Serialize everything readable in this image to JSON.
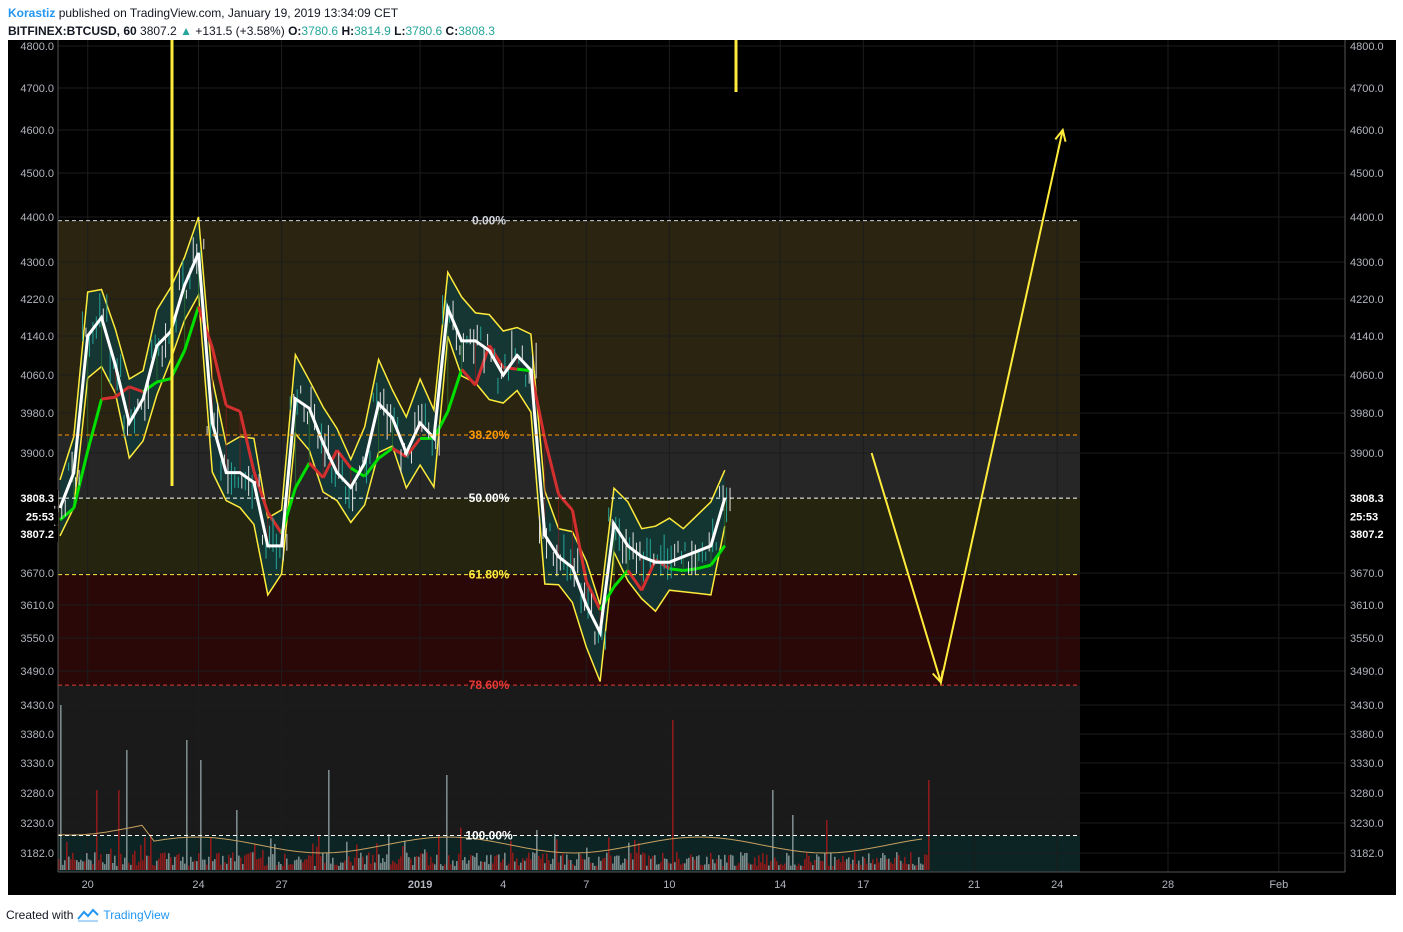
{
  "header": {
    "author": "Korastiz",
    "published": "published on TradingView.com, January 19, 2019 13:34:09 CET",
    "symbol": "BITFINEX:BTCUSD, 60",
    "last": "3807.2",
    "change": "+131.5 (+3.58%)",
    "open_label": "O:",
    "open": "3780.6",
    "high_label": "H:",
    "high": "3814.9",
    "low_label": "L:",
    "low": "3780.6",
    "close_label": "C:",
    "close": "3808.3"
  },
  "footer": {
    "created_with": "Created with",
    "brand": "TradingView"
  },
  "colors": {
    "background": "#000000",
    "up": "#26a69a",
    "author": "#2196f3",
    "fib_0": "#d1d4dc",
    "fib_38": "#ff9800",
    "fib_50": "#ffffff",
    "fib_61": "#ffeb3b",
    "fib_78": "#e53935",
    "projection": "#ffeb3b"
  },
  "chart_data": {
    "type": "line",
    "title": "BITFINEX:BTCUSD, 60",
    "x_ticks": [
      "20",
      "24",
      "27",
      "2019",
      "4",
      "7",
      "10",
      "14",
      "17",
      "21",
      "24",
      "28",
      "Feb"
    ],
    "y_ticks": [
      4800.0,
      4700.0,
      4600.0,
      4500.0,
      4400.0,
      4300.0,
      4220.0,
      4140.0,
      4060.0,
      3980.0,
      3900.0,
      3670.0,
      3610.0,
      3550.0,
      3490.0,
      3430.0,
      3380.0,
      3330.0,
      3280.0,
      3230.0,
      3182.0
    ],
    "y_tick_labels": [
      "4800.0",
      "4700.0",
      "4600.0",
      "4500.0",
      "4400.0",
      "4300.0",
      "4220.0",
      "4140.0",
      "4060.0",
      "3980.0",
      "3900.0",
      "3670.0",
      "3610.0",
      "3550.0",
      "3490.0",
      "3430.0",
      "3380.0",
      "3330.0",
      "3280.0",
      "3230.0",
      "3182.0"
    ],
    "price_markers": [
      {
        "label": "3808.3",
        "value": 3808.3
      },
      {
        "label": "25:53",
        "value": 3774
      },
      {
        "label": "3807.2",
        "value": 3742
      }
    ],
    "fib_levels": [
      {
        "label": "0.00%",
        "value": 4392
      },
      {
        "label": "38.20%",
        "value": 3936
      },
      {
        "label": "50.00%",
        "value": 3808
      },
      {
        "label": "61.80%",
        "value": 3667
      },
      {
        "label": "78.60%",
        "value": 3465
      },
      {
        "label": "100.00%",
        "value": 3210
      }
    ],
    "price_series_x": [
      0,
      0.5,
      1,
      1.5,
      2,
      2.5,
      3,
      3.5,
      4,
      4.5,
      5,
      5.5,
      6,
      6.5,
      7,
      7.5,
      8,
      8.5,
      9,
      9.5,
      10,
      10.5,
      11,
      11.5,
      12,
      12.5,
      13,
      13.5,
      14,
      14.5,
      15,
      15.5,
      16,
      16.5,
      17,
      17.5,
      18,
      18.5,
      19,
      19.5,
      20,
      20.5,
      21,
      21.5,
      22,
      22.5,
      23,
      23.5,
      24,
      24.5,
      25,
      25.5,
      26,
      26.5,
      27,
      27.5,
      28,
      28.5,
      29,
      29.5,
      30,
      30.5,
      31
    ],
    "price_series_y": [
      3790,
      3860,
      4140,
      4180,
      4080,
      3960,
      4010,
      4120,
      4150,
      4250,
      4320,
      3960,
      3860,
      3860,
      3840,
      3720,
      3720,
      4010,
      3990,
      3920,
      3860,
      3830,
      3880,
      4000,
      3970,
      3900,
      3960,
      3930,
      4200,
      4130,
      4130,
      4110,
      4060,
      4100,
      4070,
      3740,
      3700,
      3680,
      3610,
      3560,
      3760,
      3720,
      3700,
      3690,
      3690,
      3700,
      3710,
      3720,
      3808
    ],
    "projection": [
      {
        "x": 29.3,
        "y": 3900
      },
      {
        "x": 31.8,
        "y": 3470
      },
      {
        "x": 36.2,
        "y": 4600
      }
    ],
    "grid": true
  }
}
